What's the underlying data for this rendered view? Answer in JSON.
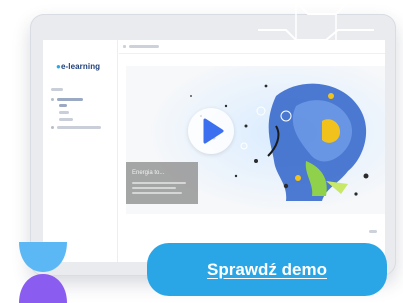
{
  "app": {
    "logo_text": "e-learning",
    "video_title": "Energia to..."
  },
  "player": {
    "play_icon": "play-icon"
  },
  "cta": {
    "label": "Sprawdź demo"
  },
  "colors": {
    "accent": "#2aa6e6",
    "play": "#3b6ff0",
    "logo": "#1d3f7a",
    "blob_top": "#5bb8f5",
    "blob_bottom": "#8b5cf0"
  }
}
